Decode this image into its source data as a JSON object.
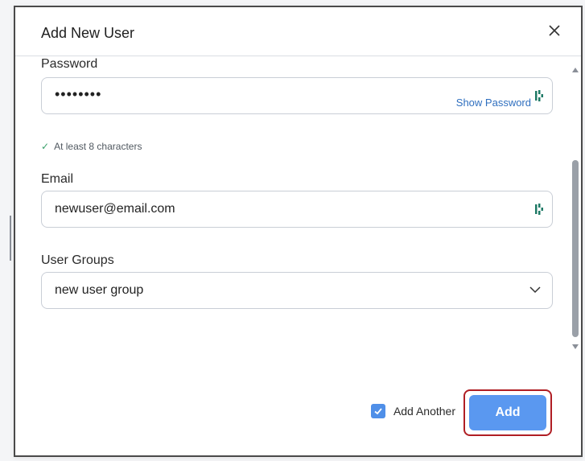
{
  "dialog": {
    "title": "Add New User"
  },
  "password": {
    "label": "Password",
    "value": "••••••••",
    "show_label": "Show Password",
    "hint": "At least 8 characters"
  },
  "email": {
    "label": "Email",
    "value": "newuser@email.com"
  },
  "groups": {
    "label": "User Groups",
    "selected": "new user group"
  },
  "footer": {
    "add_another_label": "Add Another",
    "add_another_checked": true,
    "add_label": "Add"
  },
  "colors": {
    "accent": "#5a98f0",
    "link": "#2f6fbf",
    "highlight_border": "#b01e24",
    "check": "#3aa06a"
  },
  "icons": [
    "close-icon",
    "password-manager-icon",
    "chevron-down-icon",
    "check-icon"
  ]
}
